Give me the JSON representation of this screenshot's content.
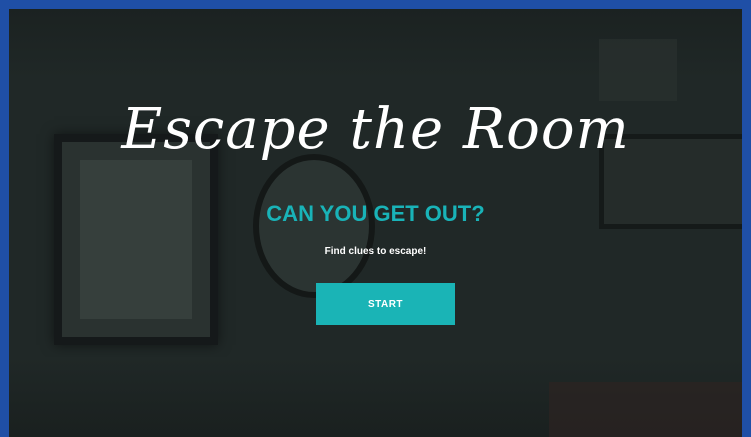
{
  "game": {
    "title": "Escape the Room",
    "subtitle": "CAN YOU GET OUT?",
    "tagline": "Find clues to escape!",
    "start_label": "START"
  },
  "colors": {
    "frame": "#1f4fa6",
    "scene_bg": "#202827",
    "accent": "#1ab4b6",
    "text": "#ffffff"
  }
}
